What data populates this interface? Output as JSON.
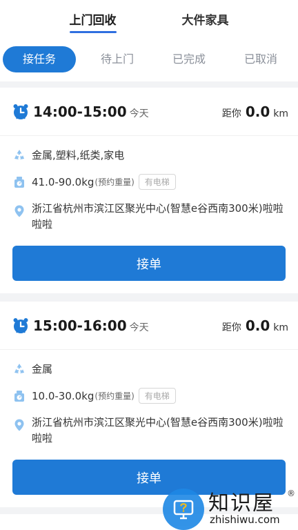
{
  "top_tabs": [
    {
      "label": "上门回收",
      "active": true
    },
    {
      "label": "大件家具",
      "active": false
    }
  ],
  "sub_tabs": [
    {
      "label": "接任务",
      "active": true
    },
    {
      "label": "待上门",
      "active": false
    },
    {
      "label": "已完成",
      "active": false
    },
    {
      "label": "已取消",
      "active": false
    }
  ],
  "orders": [
    {
      "time": "14:00-15:00",
      "day": "今天",
      "distance_label": "距你",
      "distance_value": "0.0",
      "distance_unit": "km",
      "categories": "金属,塑料,纸类,家电",
      "weight": "41.0-90.0kg",
      "weight_note": "(预约重量)",
      "elevator_badge": "有电梯",
      "address": "浙江省杭州市滨江区聚光中心(智慧e谷西南300米)啦啦啦啦",
      "accept_label": "接单"
    },
    {
      "time": "15:00-16:00",
      "day": "今天",
      "distance_label": "距你",
      "distance_value": "0.0",
      "distance_unit": "km",
      "categories": "金属",
      "weight": "10.0-30.0kg",
      "weight_note": "(预约重量)",
      "elevator_badge": "有电梯",
      "address": "浙江省杭州市滨江区聚光中心(智慧e谷西南300米)啦啦啦啦",
      "accept_label": "接单"
    }
  ],
  "watermark": {
    "title": "知识屋",
    "url": "zhishiwu.com",
    "reg": "®"
  },
  "colors": {
    "accent": "#1f7ad6",
    "icon_blue": "#5aa7e8"
  }
}
